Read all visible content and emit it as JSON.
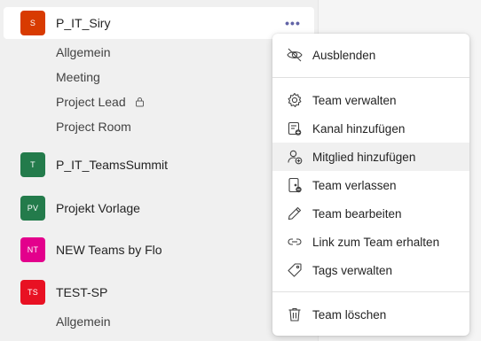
{
  "teams": [
    {
      "name": "P_IT_Siry",
      "initials": "S",
      "color": "#d83b01",
      "selected": true,
      "more_label": "•••",
      "channels": [
        {
          "name": "Allgemein",
          "locked": false
        },
        {
          "name": "Meeting",
          "locked": false
        },
        {
          "name": "Project Lead",
          "locked": true
        },
        {
          "name": "Project Room",
          "locked": false
        }
      ]
    },
    {
      "name": "P_IT_TeamsSummit",
      "initials": "T",
      "color": "#237b4b"
    },
    {
      "name": "Projekt Vorlage",
      "initials": "PV",
      "color": "#237b4b"
    },
    {
      "name": "NEW Teams by Flo",
      "initials": "NT",
      "color": "#e3008c"
    },
    {
      "name": "TEST-SP",
      "initials": "TS",
      "color": "#e81123",
      "channels": [
        {
          "name": "Allgemein",
          "locked": false
        }
      ]
    }
  ],
  "context_menu": {
    "items": [
      {
        "label": "Ausblenden",
        "icon": "eye-off-icon"
      },
      {
        "label": "Team verwalten",
        "icon": "gear-icon"
      },
      {
        "label": "Kanal hinzufügen",
        "icon": "add-channel-icon"
      },
      {
        "label": "Mitglied hinzufügen",
        "icon": "add-person-icon",
        "hovered": true
      },
      {
        "label": "Team verlassen",
        "icon": "leave-team-icon"
      },
      {
        "label": "Team bearbeiten",
        "icon": "pencil-icon"
      },
      {
        "label": "Link zum Team erhalten",
        "icon": "link-icon"
      },
      {
        "label": "Tags verwalten",
        "icon": "tag-icon"
      },
      {
        "label": "Team löschen",
        "icon": "trash-icon"
      }
    ]
  }
}
